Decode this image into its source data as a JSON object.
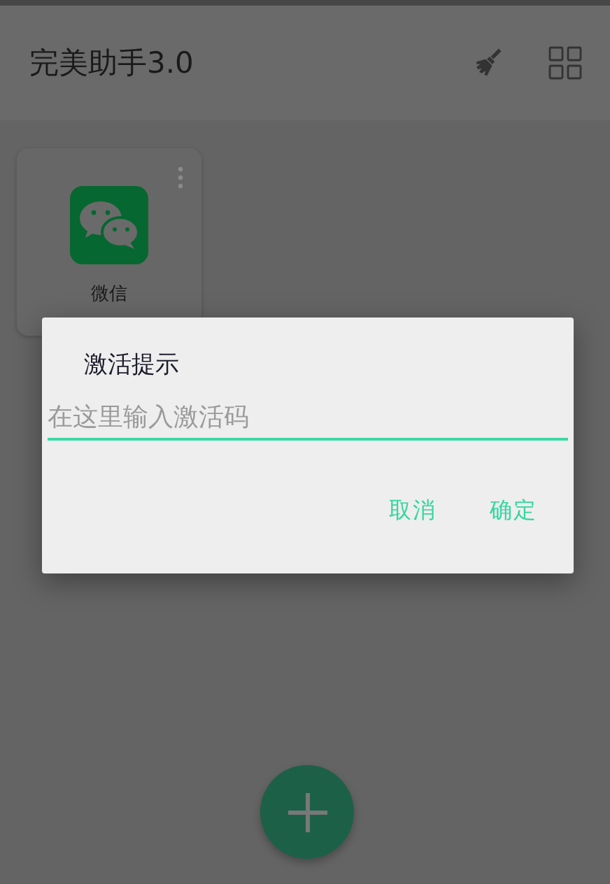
{
  "app_bar": {
    "title": "完美助手3.0"
  },
  "apps": [
    {
      "label": "微信"
    }
  ],
  "dialog": {
    "title": "激活提示",
    "field": {
      "placeholder": "在这里输入激活码"
    },
    "buttons": [
      "取消",
      "确定"
    ]
  }
}
